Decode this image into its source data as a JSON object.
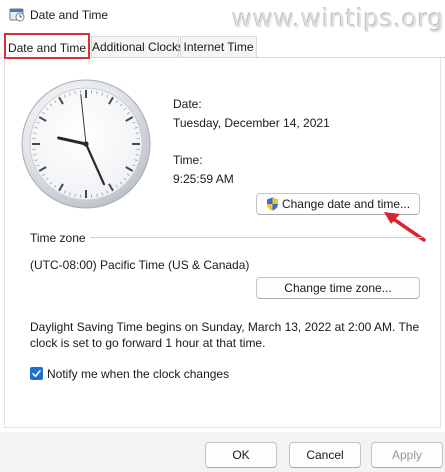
{
  "window": {
    "title": "Date and Time",
    "watermark": "www.wintips.org"
  },
  "tabs": [
    {
      "label": "Date and Time",
      "active": true
    },
    {
      "label": "Additional Clocks",
      "active": false
    },
    {
      "label": "Internet Time",
      "active": false
    }
  ],
  "clock": {
    "hour": 9,
    "minute": 25,
    "second": 59
  },
  "date": {
    "label": "Date:",
    "value": "Tuesday, December 14, 2021"
  },
  "time": {
    "label": "Time:",
    "value": "9:25:59 AM"
  },
  "buttons": {
    "change_date_time": "Change date and time...",
    "change_time_zone": "Change time zone...",
    "ok": "OK",
    "cancel": "Cancel",
    "apply": "Apply"
  },
  "timezone": {
    "section_label": "Time zone",
    "value": "(UTC-08:00) Pacific Time (US & Canada)"
  },
  "dst": {
    "line1": "Daylight Saving Time begins on Sunday, March 13, 2022 at 2:00 AM. The",
    "line2": "clock is set to go forward 1 hour at that time."
  },
  "notify": {
    "label": "Notify me when the clock changes",
    "checked": true
  },
  "colors": {
    "highlight": "#d6333a",
    "accent": "#1f6fd1",
    "arrow": "#d6262e"
  },
  "icons": {
    "app": "date-time-app-icon",
    "shield": "uac-shield-icon",
    "checkbox": "checkmark-icon",
    "arrow": "red-annotation-arrow"
  }
}
